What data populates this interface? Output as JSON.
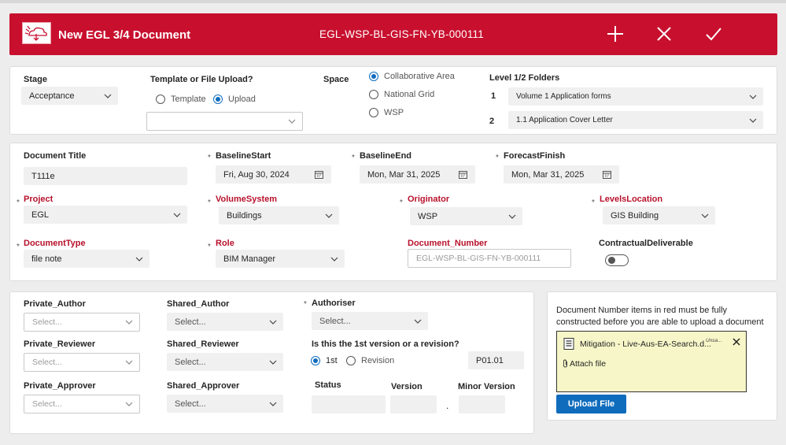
{
  "header": {
    "title": "New EGL 3/4 Document",
    "doc_number": "EGL-WSP-BL-GIS-FN-YB-000111",
    "add_label": "+",
    "close_label": "×",
    "confirm_label": "✓"
  },
  "top_section": {
    "stage": {
      "label": "Stage",
      "value": "Acceptance"
    },
    "template_upload": {
      "label": "Template or File Upload?",
      "options": [
        "Template",
        "Upload"
      ],
      "selected": "Upload",
      "dropdown_value": ""
    },
    "space": {
      "label": "Space",
      "options": [
        "Collaborative Area",
        "National Grid",
        "WSP"
      ],
      "selected": "Collaborative Area"
    },
    "folders": {
      "label": "Level 1/2 Folders",
      "items": [
        {
          "num": "1",
          "value": "Volume 1 Application forms"
        },
        {
          "num": "2",
          "value": "1.1 Application Cover Letter"
        }
      ]
    }
  },
  "details": {
    "document_title": {
      "label": "Document Title",
      "value": "T111e"
    },
    "baseline_start": {
      "label": "BaselineStart",
      "value": "Fri, Aug 30, 2024"
    },
    "baseline_end": {
      "label": "BaselineEnd",
      "value": "Mon, Mar 31, 2025"
    },
    "forecast_finish": {
      "label": "ForecastFinish",
      "value": "Mon, Mar 31, 2025"
    },
    "project": {
      "label": "Project",
      "value": "EGL"
    },
    "volume_system": {
      "label": "VolumeSystem",
      "value": "Buildings"
    },
    "originator": {
      "label": "Originator",
      "value": "WSP"
    },
    "levels_location": {
      "label": "LevelsLocation",
      "value": "GIS Building"
    },
    "document_type": {
      "label": "DocumentType",
      "value": "file note"
    },
    "role": {
      "label": "Role",
      "value": "BIM Manager"
    },
    "document_number": {
      "label": "Document_Number",
      "placeholder": "EGL-WSP-BL-GIS-FN-YB-000111"
    },
    "contractual": {
      "label": "ContractualDeliverable",
      "value": false
    }
  },
  "people": {
    "private_author": {
      "label": "Private_Author",
      "placeholder": "Select..."
    },
    "private_reviewer": {
      "label": "Private_Reviewer",
      "placeholder": "Select..."
    },
    "private_approver": {
      "label": "Private_Approver",
      "placeholder": "Select..."
    },
    "shared_author": {
      "label": "Shared_Author",
      "placeholder": "Select..."
    },
    "shared_reviewer": {
      "label": "Shared_Reviewer",
      "placeholder": "Select..."
    },
    "shared_approver": {
      "label": "Shared_Approver",
      "placeholder": "Select..."
    },
    "authoriser": {
      "label": "Authoriser",
      "placeholder": "Select..."
    },
    "version_question": {
      "label": "Is this the 1st version or a revision?",
      "options": [
        "1st",
        "Revision"
      ],
      "selected": "1st",
      "code": "P01.01"
    },
    "status": {
      "label": "Status",
      "value": ""
    },
    "version": {
      "label": "Version",
      "value": ""
    },
    "dot": ".",
    "minor_version": {
      "label": "Minor Version",
      "value": ""
    }
  },
  "upload_panel": {
    "message": "Document Number items in red must be fully constructed before you are able to upload a document",
    "file_name": "Mitigation - Live-Aus-EA-Search.d...",
    "file_status": "Unsa...",
    "attach_label": "Attach file",
    "button_label": "Upload File"
  },
  "colors": {
    "header_bg": "#c8102e",
    "required_label": "#b8112b",
    "primary": "#0f6cbd",
    "attach_bg": "#f6f6c8"
  }
}
